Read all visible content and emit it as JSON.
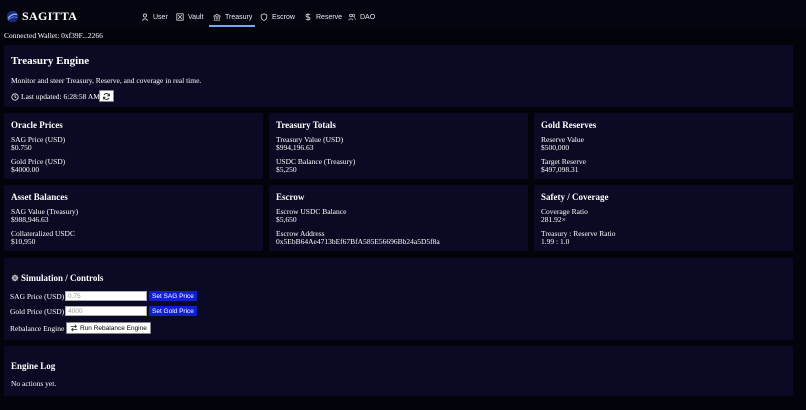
{
  "nav": {
    "brand": "SAGITTA",
    "items": [
      {
        "label": "User",
        "icon": "user-icon"
      },
      {
        "label": "Vault",
        "icon": "vault-icon"
      },
      {
        "label": "Treasury",
        "icon": "bank-icon",
        "active": true
      },
      {
        "label": "Escrow",
        "icon": "shield-icon"
      },
      {
        "label": "Reserve",
        "icon": "dollar-icon"
      },
      {
        "label": "DAO",
        "icon": "users-icon"
      }
    ]
  },
  "wallet": "Connected Wallet: 0xf39F...2266",
  "header": {
    "title": "Treasury Engine",
    "subtitle": "Monitor and steer Treasury, Reserve, and coverage in real time.",
    "last_updated": "Last updated: 6:28:58 AM"
  },
  "cards": {
    "oracle": {
      "title": "Oracle Prices",
      "sag_label": "SAG Price (USD)",
      "sag_value": "$0.750",
      "gold_label": "Gold Price (USD)",
      "gold_value": "$4000.00"
    },
    "treasury": {
      "title": "Treasury Totals",
      "value_label": "Treasury Value (USD)",
      "value": "$994,196.63",
      "usdc_label": "USDC Balance (Treasury)",
      "usdc_value": "$5,250"
    },
    "gold": {
      "title": "Gold Reserves",
      "reserve_label": "Reserve Value",
      "reserve_value": "$500,000",
      "target_label": "Target Reserve",
      "target_value": "$497,098.31"
    },
    "assets": {
      "title": "Asset Balances",
      "sag_label": "SAG Value (Treasury)",
      "sag_value": "$988,946.63",
      "collat_label": "Collateralized USDC",
      "collat_value": "$10,950"
    },
    "escrow": {
      "title": "Escrow",
      "balance_label": "Escrow USDC Balance",
      "balance_value": "$5,650",
      "address_label": "Escrow Address",
      "address_value": "0x5EbB64Ae4713bEf67BfA585E56696Bb24a5D5f8a"
    },
    "safety": {
      "title": "Safety / Coverage",
      "coverage_label": "Coverage Ratio",
      "coverage_value": "281.92×",
      "ratio_label": "Treasury : Reserve Ratio",
      "ratio_value": "1.99 : 1.0"
    }
  },
  "simulation": {
    "title": "Simulation / Controls",
    "sag_label": "SAG Price (USD)",
    "sag_placeholder": "0.75",
    "sag_button": "Set SAG Price",
    "gold_label": "Gold Price (USD)",
    "gold_placeholder": "4000",
    "gold_button": "Set Gold Price",
    "rebalance_label": "Rebalance Engine",
    "rebalance_button": "Run Rebalance Engine"
  },
  "log": {
    "title": "Engine Log",
    "message": "No actions yet."
  },
  "colors": {
    "background": "#03030c",
    "panel": "#0a0a24",
    "accent_button": "#0f1fd0",
    "active_underline": "#7aa3ff"
  }
}
